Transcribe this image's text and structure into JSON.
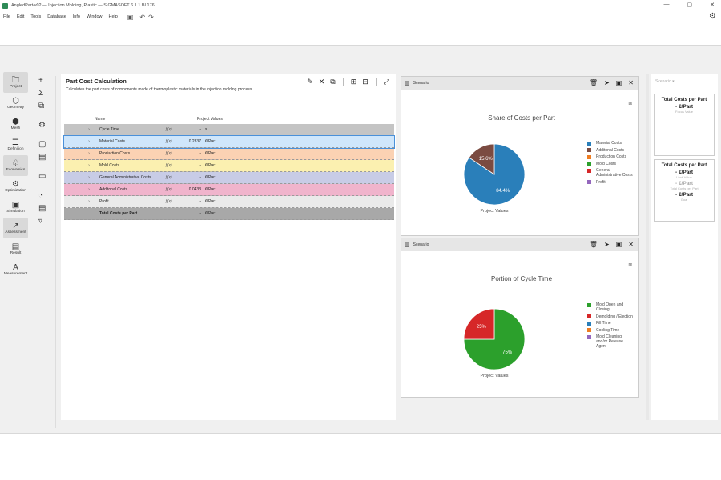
{
  "window": {
    "title": "AngledPart/v02 — Injection Molding, Plastic — SIGMASOFT 6.1.1 BL176",
    "controls": [
      "—",
      "▢",
      "✕"
    ]
  },
  "menu": [
    "File",
    "Edit",
    "Tools",
    "Database",
    "Info",
    "Window",
    "Help"
  ],
  "nav": [
    {
      "label": "Project",
      "icon": "folder-icon",
      "glyph": "🗀",
      "active": true
    },
    {
      "label": "Geometry",
      "icon": "cube-icon",
      "glyph": "⬡",
      "active": false
    },
    {
      "label": "Mesh",
      "icon": "mesh-icon",
      "glyph": "⬢",
      "active": false
    },
    {
      "label": "Definition",
      "icon": "definition-icon",
      "glyph": "☰",
      "active": false
    },
    {
      "label": "Economics",
      "icon": "leaf-icon",
      "glyph": "♧",
      "active": true
    },
    {
      "label": "Optimization",
      "icon": "optimization-icon",
      "glyph": "⚙",
      "active": false
    },
    {
      "label": "Simulation",
      "icon": "simulation-icon",
      "glyph": "▣",
      "active": false
    },
    {
      "label": "Assessment",
      "icon": "chart-icon",
      "glyph": "↗",
      "active": true
    },
    {
      "label": "Result",
      "icon": "result-icon",
      "glyph": "▤",
      "active": false
    },
    {
      "label": "Measurement",
      "icon": "ruler-icon",
      "glyph": "A",
      "active": false
    }
  ],
  "main": {
    "title": "Part Cost Calculation",
    "description": "Calculates the part costs of components made of thermoplastic materials in the injection molding process.",
    "columns": {
      "name": "Name",
      "values": "Project Values"
    },
    "rows": [
      {
        "dots": "...",
        "exp": "›",
        "name": "Cycle Time",
        "fx": "ƒ(x)",
        "value": "-",
        "unit": "s",
        "bg": "#c4c4c4",
        "bold": false
      },
      {
        "dots": "",
        "exp": "›",
        "name": "Material Costs",
        "fx": "ƒ(x)",
        "value": "0.2337",
        "unit": "€/Part",
        "bg": "#cfe6fb",
        "bold": false
      },
      {
        "dots": "",
        "exp": "›",
        "name": "Production Costs",
        "fx": "ƒ(x)",
        "value": "-",
        "unit": "€/Part",
        "bg": "#fbd2b3",
        "bold": false
      },
      {
        "dots": "",
        "exp": "›",
        "name": "Mold Costs",
        "fx": "ƒ(x)",
        "value": "-",
        "unit": "€/Part",
        "bg": "#fbf0b0",
        "bold": false
      },
      {
        "dots": "",
        "exp": "›",
        "name": "General Administrative Costs",
        "fx": "ƒ(x)",
        "value": "-",
        "unit": "€/Part",
        "bg": "#c8cce6",
        "bold": false
      },
      {
        "dots": "",
        "exp": "›",
        "name": "Additonal Costs",
        "fx": "ƒ(x)",
        "value": "0.0433",
        "unit": "€/Part",
        "bg": "#f0b4cc",
        "bold": false
      },
      {
        "dots": "",
        "exp": "›",
        "name": "Profit",
        "fx": "ƒ(x)",
        "value": "-",
        "unit": "€/Part",
        "bg": "#eaeaea",
        "bold": false
      },
      {
        "dots": "",
        "exp": "",
        "name": "Total Costs per Part",
        "fx": "",
        "value": "-",
        "unit": "€/Part",
        "bg": "#a8a8a8",
        "bold": true
      }
    ]
  },
  "scenario_label": "Scenario",
  "chart_data": [
    {
      "type": "pie",
      "title": "Share of Costs per Part",
      "xlabel": "Project Values",
      "categories": [
        "Material Costs",
        "Additonal Costs",
        "Production Costs",
        "Mold Costs",
        "General Administrative Costs",
        "Profit"
      ],
      "legend_labels": [
        "Material Costs",
        "Additonal Costs",
        "Production Costs",
        "Mold Costs",
        "General Administrative Costs",
        "Profit"
      ],
      "values": [
        84.4,
        15.6,
        0,
        0,
        0,
        0
      ],
      "slice_labels": [
        "84.4%",
        "15.6%"
      ],
      "colors": [
        "#2a7fba",
        "#7b4b41",
        "#ef7d21",
        "#2ca02c",
        "#d62728",
        "#9467bd"
      ],
      "legend": "right"
    },
    {
      "type": "pie",
      "title": "Portion of Cycle Time",
      "xlabel": "Project Values",
      "categories": [
        "Mold Open and Closing",
        "Demolding / Ejection",
        "Fill Time",
        "Cooling Time",
        "Mold Cleaning and/or Release Agent"
      ],
      "legend_labels": [
        "Mold Open and Closing",
        "Demolding / Ejection",
        "Fill Time",
        "Cooling Time",
        "Mold Cleaning and/or Release Agent"
      ],
      "values": [
        75,
        25,
        0,
        0,
        0
      ],
      "slice_labels": [
        "75%",
        "25%"
      ],
      "colors": [
        "#2ca02c",
        "#d62728",
        "#2a7fba",
        "#ef7d21",
        "#9467bd"
      ],
      "legend": "right"
    }
  ],
  "right_panel": {
    "scenario": "Scenario ▾",
    "card1": {
      "title": "Total Costs per Part",
      "value": "- €/Part",
      "label": "Focus Value"
    },
    "card2": {
      "title": "Total Costs per Part",
      "value1": "- €/Part",
      "label1": "Limit Value",
      "value2": "- €/Part",
      "label2": "Total Costs per Part",
      "value3": "- €/Part",
      "label3": "Goal"
    }
  }
}
